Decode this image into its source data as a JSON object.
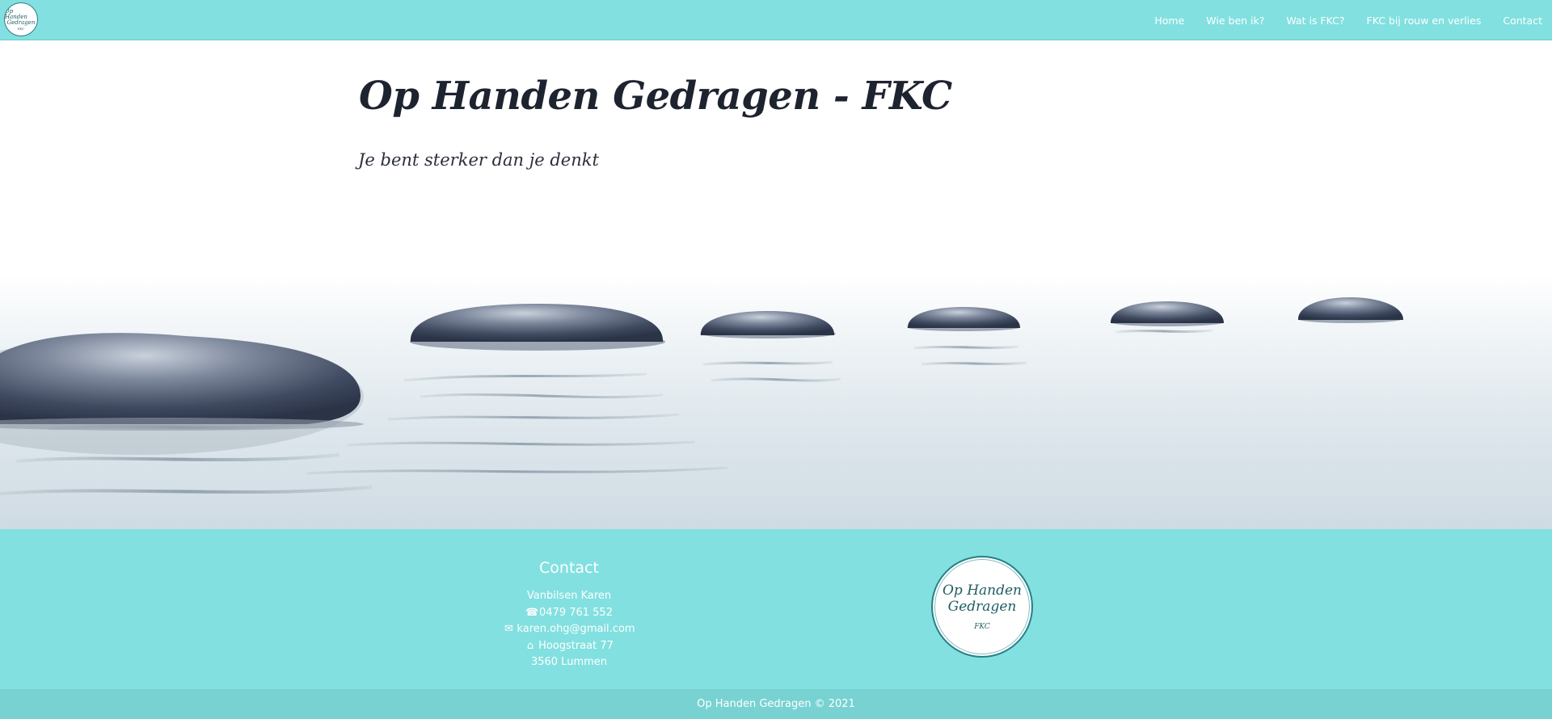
{
  "nav": {
    "logo": {
      "line1": "Op Handen",
      "line2": "Gedragen",
      "line3": "FKC"
    },
    "links": [
      {
        "label": "Home"
      },
      {
        "label": "Wie ben ik?"
      },
      {
        "label": "Wat is FKC?"
      },
      {
        "label": "FKC bij rouw en verlies"
      },
      {
        "label": "Contact"
      }
    ]
  },
  "hero": {
    "title": "Op Handen Gedragen - FKC",
    "subtitle": "Je bent sterker dan je denkt",
    "image": "stepping-stones-on-water"
  },
  "contact": {
    "heading": "Contact",
    "name": "Vanbilsen Karen",
    "phone_icon": "☎",
    "phone": "0479 761 552",
    "email_icon": "✉",
    "email": "karen.ohg@gmail.com",
    "home_icon": "⌂",
    "street": "Hoogstraat 77",
    "city": "3560 Lummen"
  },
  "footer_logo": {
    "line1": "Op Handen",
    "line2": "Gedragen",
    "line3": "FKC"
  },
  "copyright": "Op Handen Gedragen © 2021",
  "colors": {
    "accent": "#82e0e0",
    "footer_bar": "#78d2d2",
    "text": "#ffffff"
  }
}
